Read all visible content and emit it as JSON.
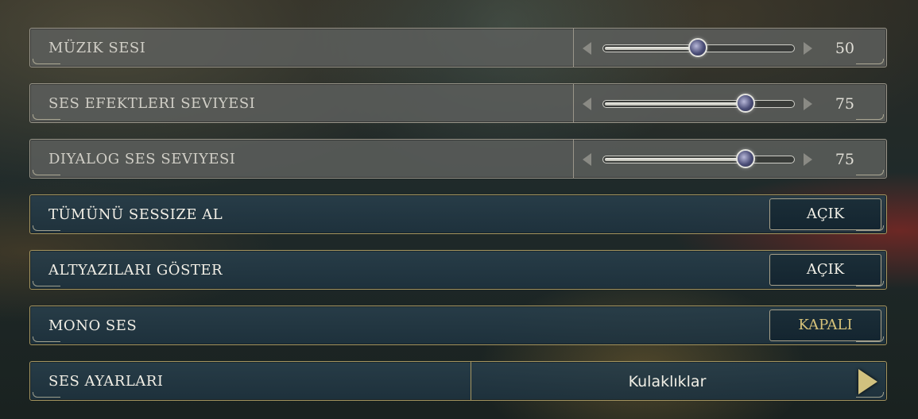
{
  "settings": {
    "music": {
      "label": "MÜZIK SESI",
      "value": "50",
      "level": 50
    },
    "sfx": {
      "label": "SES EFEKTLERI SEVIYESI",
      "value": "75",
      "level": 75
    },
    "dialog": {
      "label": "DIYALOG SES SEVIYESI",
      "value": "75",
      "level": 75
    },
    "mute_all": {
      "label": "TÜMÜNÜ SESSIZE AL",
      "value": "AÇIK"
    },
    "subtitles": {
      "label": "ALTYAZILARI GÖSTER",
      "value": "AÇIK"
    },
    "mono": {
      "label": "MONO SES",
      "value": "KAPALI"
    },
    "audio_output": {
      "label": "SES AYARLARI",
      "value": "Kulaklıklar"
    }
  },
  "icons": [
    "chevron-left-icon",
    "chevron-right-icon",
    "slider-knob-icon",
    "next-arrow-icon"
  ],
  "colors": {
    "accent_gold": "#d6c27a",
    "row_slider": "#5c5e5c",
    "row_toggle": "#1e3440"
  }
}
